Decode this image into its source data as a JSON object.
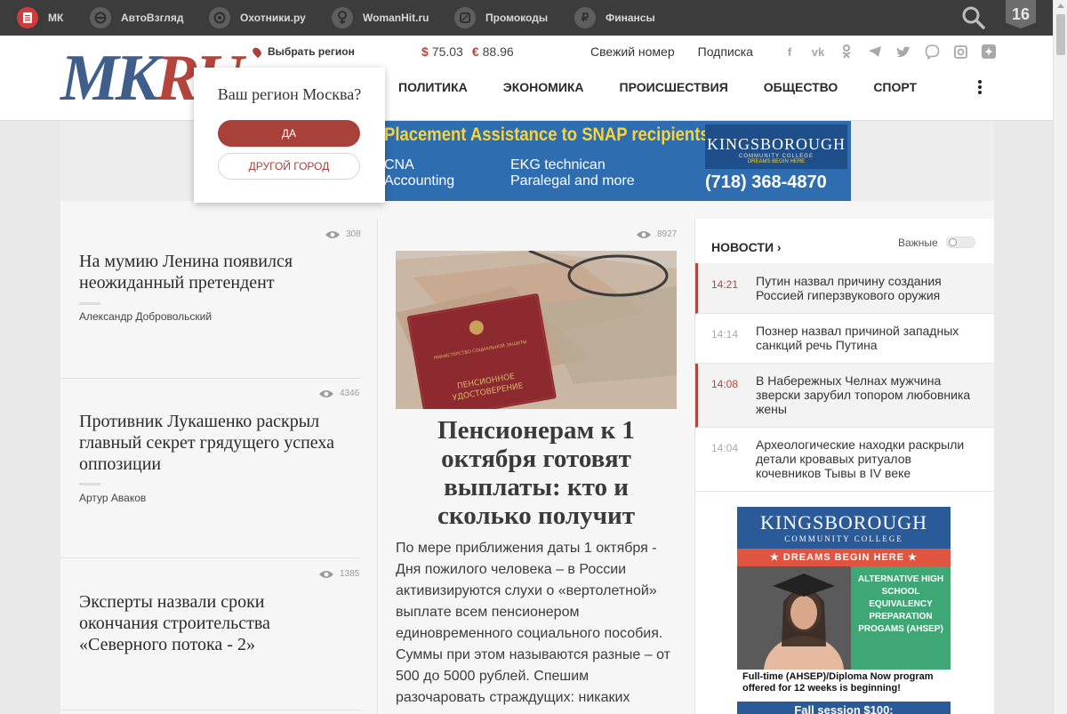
{
  "network": [
    {
      "label": "МК",
      "icon": "document-icon"
    },
    {
      "label": "АвтоВзгляд",
      "icon": "steering-wheel-icon"
    },
    {
      "label": "Охотники.ру",
      "icon": "target-icon"
    },
    {
      "label": "WomanHit.ru",
      "icon": "female-icon"
    },
    {
      "label": "Промокоды",
      "icon": "percent-icon"
    },
    {
      "label": "Финансы",
      "icon": "ruble-icon"
    }
  ],
  "age_rating": "16",
  "logo": {
    "mk": "MK",
    "ru": "RU"
  },
  "region_link": "Выбрать регион",
  "rates": {
    "usd_symbol": "$",
    "usd": "75.03",
    "eur_symbol": "€",
    "eur": "88.96"
  },
  "top_links": [
    "Свежий номер",
    "Подписка"
  ],
  "socials": [
    "facebook-icon",
    "vk-icon",
    "odnoklassniki-icon",
    "telegram-icon",
    "twitter-icon",
    "viber-icon",
    "instagram-icon",
    "yandex-zen-icon"
  ],
  "nav": [
    "ПОЛИТИКА",
    "ЭКОНОМИКА",
    "ПРОИСШЕСТВИЯ",
    "ОБЩЕСТВО",
    "СПОРТ"
  ],
  "banner": {
    "headline": "Placement Assistance to SNAP recipients",
    "line1a": "CNA",
    "line1b": "Accounting",
    "line2a": "EKG technican",
    "line2b": "Paralegal and more",
    "brand": "KINGSBOROUGH",
    "brand_sub": "COMMUNITY COLLEGE",
    "brand_tag": "DREAMS BEGIN HERE",
    "phone": "(718) 368-4870"
  },
  "region_popup": {
    "question": "Ваш регион Москва?",
    "yes": "ДА",
    "other": "ДРУГОЙ ГОРОД"
  },
  "articles": [
    {
      "views": "308",
      "title": "На мумию Ленина появился неожиданный претендент",
      "author": "Александр Добровольский"
    },
    {
      "views": "4346",
      "title": "Противник Лукашенко раскрыл главный секрет грядущего успеха оппозиции",
      "author": "Артур Аваков"
    },
    {
      "views": "1385",
      "title": "Эксперты назвали сроки окончания строительства «Северного потока - 2»",
      "author": ""
    }
  ],
  "featured": {
    "views": "8927",
    "title": "Пенсионерам к 1 октября готовят выплаты: кто и сколько получит",
    "lead": "По мере приближения даты 1 октября - Дня пожилого человека – в России активизируются слухи о «вертолетной» выплате всем пенсионером единовременного социального пособия. Суммы при этом называются разные – от 500 до 5000 рублей. Спешим разочаровать страждущих: никаких",
    "image_doc_text": "ПЕНСИОННОЕ УДОСТОВЕРЕНИЕ",
    "image_doc_top": "МИНИСТЕРСТВО СОЦИАЛЬНОЙ ЗАЩИТЫ НАСЕЛЕНИЯ РОССИЙСКОЙ ФЕДЕРАЦИИ"
  },
  "news": {
    "heading": "НОВОСТИ",
    "important_label": "Важные",
    "items": [
      {
        "time": "14:21",
        "text": "Путин назвал причину создания Россией гиперзвукового оружия",
        "highlight": true
      },
      {
        "time": "14:14",
        "text": "Познер назвал причиной западных санкций речь Путина",
        "highlight": false
      },
      {
        "time": "14:08",
        "text": "В Набережных Челнах мужчина зверски зарубил топором любовника жены",
        "highlight": true
      },
      {
        "time": "14:04",
        "text": "Археологические находки раскрыли детали кровавых ритуалов кочевников Тывы в IV веке",
        "highlight": false
      }
    ]
  },
  "side_ad": {
    "brand": "KINGSBOROUGH",
    "brand_sub": "COMMUNITY COLLEGE",
    "tag": "★ DREAMS BEGIN HERE ★",
    "program": "ALTERNATIVE HIGH SCHOOL EQUIVALENCY PREPARATION PROGAMS (AHSEP)",
    "body": "Full-time (AHSEP)/Diploma Now program offered for 12 weeks is beginning!",
    "footer": "Fall session $100:"
  },
  "colors": {
    "accent": "#b5453c",
    "dark_bar": "#3c3c3c",
    "logo_blue": "#3f5f8a"
  }
}
